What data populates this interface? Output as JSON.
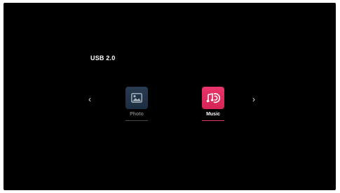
{
  "header": {
    "source_title": "USB 2.0"
  },
  "navigation": {
    "prev_icon": "chevron-left-icon",
    "prev_glyph": "‹",
    "next_icon": "chevron-right-icon",
    "next_glyph": "›"
  },
  "tiles": [
    {
      "label": "Photo",
      "icon": "photo-icon",
      "selected": false
    },
    {
      "label": "Music",
      "icon": "music-icon",
      "selected": true
    }
  ],
  "colors": {
    "background": "#000000",
    "photo_tile": "#2a3f57",
    "music_tile": "#e2305f",
    "selected_underline": "#e23a52"
  }
}
